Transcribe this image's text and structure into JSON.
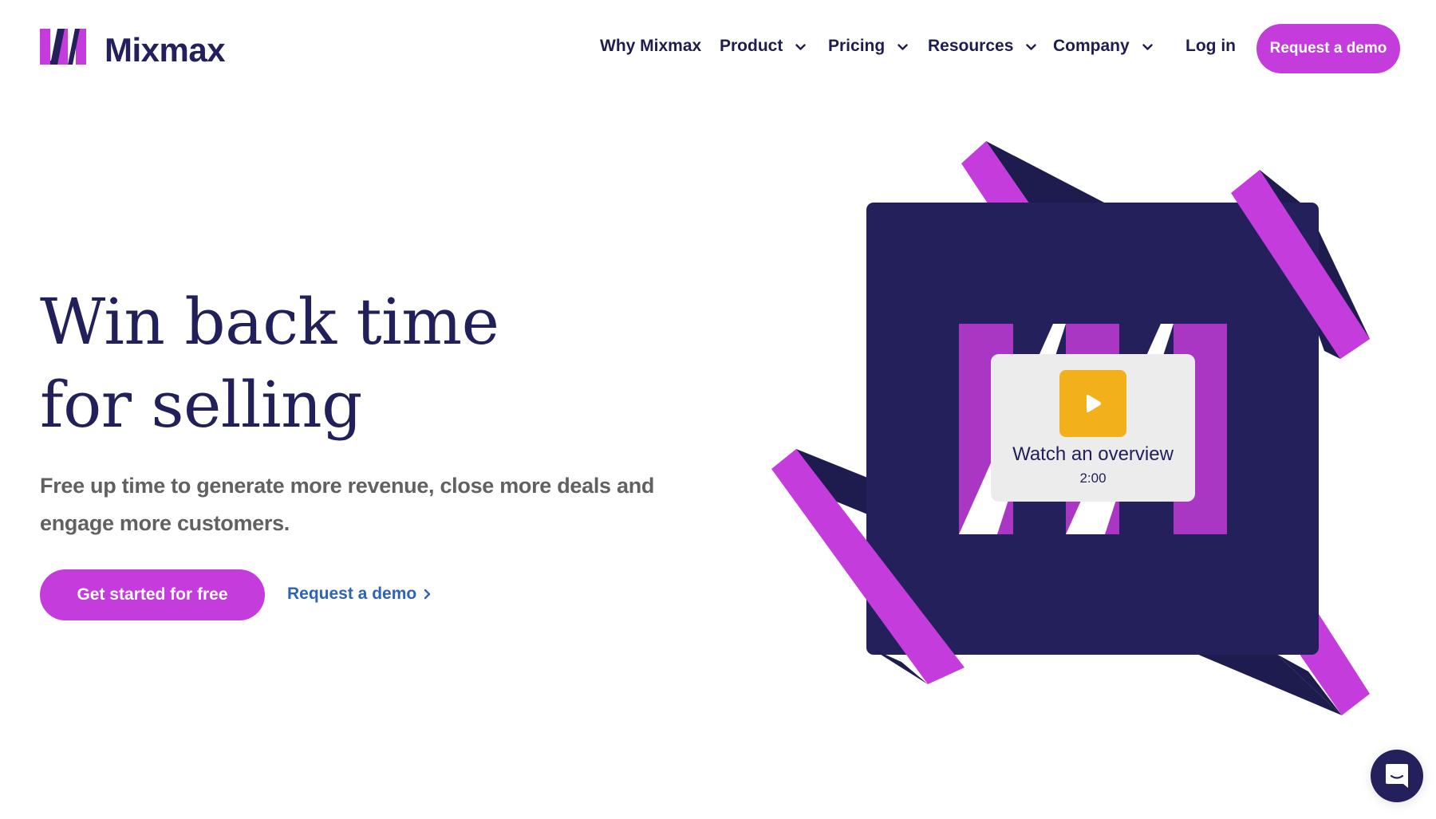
{
  "header": {
    "logo_text": "Mixmax",
    "nav": [
      {
        "label": "Why Mixmax",
        "has_dropdown": false
      },
      {
        "label": "Product",
        "has_dropdown": true
      },
      {
        "label": "Pricing",
        "has_dropdown": true
      },
      {
        "label": "Resources",
        "has_dropdown": true
      },
      {
        "label": "Company",
        "has_dropdown": true
      }
    ],
    "login_label": "Log in",
    "cta_label": "Request a demo"
  },
  "hero": {
    "title_line1": "Win back time",
    "title_line2": "for selling",
    "subtitle": "Free up time to generate more revenue, close more deals and engage more customers.",
    "primary_cta": "Get started for free",
    "secondary_cta": "Request a demo",
    "secondary_cta_icon": "chevron-right-icon"
  },
  "video_card": {
    "icon": "play-icon",
    "title": "Watch an overview",
    "duration": "2:00"
  },
  "chat_widget": {
    "icon": "chat-bubble-icon"
  },
  "colors": {
    "brand_purple": "#c43cdb",
    "navy": "#23205c",
    "dark_navy": "#1e1c4e",
    "play_yellow": "#f2b11a",
    "link_blue": "#2f63b4",
    "subtitle_gray": "#616161"
  }
}
